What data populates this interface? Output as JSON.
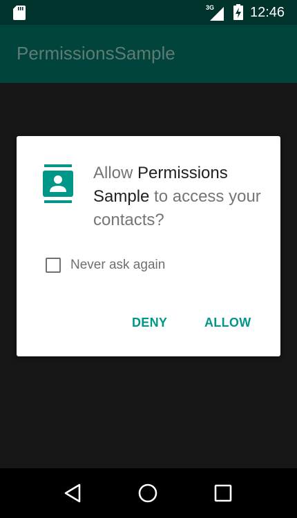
{
  "status_bar": {
    "network_type": "3G",
    "time": "12:46",
    "icons": [
      "sd-card-icon",
      "cell-signal-icon",
      "battery-charging-icon"
    ]
  },
  "app_bar": {
    "title": "PermissionsSample"
  },
  "dialog": {
    "icon": "contacts-icon",
    "message_prefix": "Allow ",
    "app_name": "Permissions Sample",
    "message_suffix": " to access your contacts?",
    "checkbox_label": "Never ask again",
    "checkbox_checked": false,
    "deny_label": "DENY",
    "allow_label": "ALLOW",
    "accent_color": "#009688"
  },
  "nav_bar": {
    "icons": [
      "back-icon",
      "home-icon",
      "recents-icon"
    ]
  },
  "colors": {
    "status_bar": "#00332b",
    "app_bar": "#00443c",
    "app_title": "#5f7b76",
    "background": "#171717",
    "dialog": "#ffffff",
    "accent": "#009688"
  }
}
